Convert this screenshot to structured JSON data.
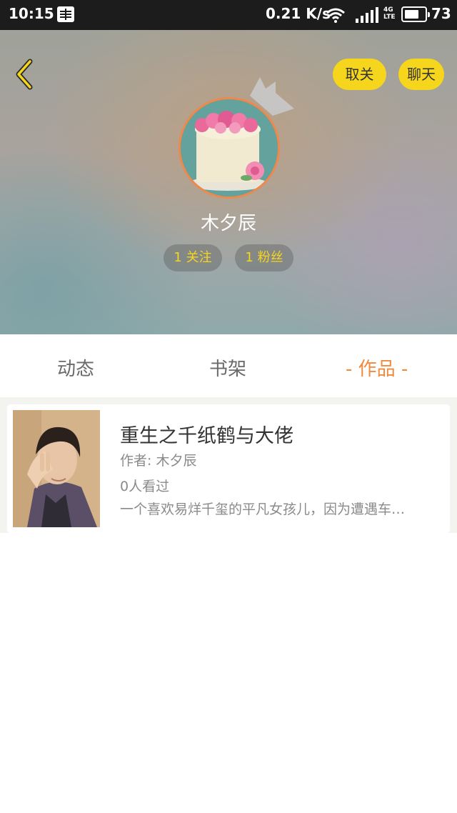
{
  "status_bar": {
    "time": "10:15",
    "speed": "0.21 K/s",
    "network_type": "4G LTE",
    "battery": "73",
    "battery_level": 0.73,
    "icons": [
      "reader-icon",
      "wifi-icon",
      "signal-icon",
      "battery-icon"
    ]
  },
  "header": {
    "back_icon": "chevron-left-icon",
    "unfollow_label": "取关",
    "chat_label": "聊天",
    "username": "木夕辰",
    "following": "1 关注",
    "fans": "1 粉丝"
  },
  "tabs": [
    {
      "label": "动态",
      "active": false
    },
    {
      "label": "书架",
      "active": false
    },
    {
      "label": "- 作品 -",
      "active": true
    }
  ],
  "works": [
    {
      "title": "重生之千纸鹤与大佬",
      "author_label": "作者: ",
      "author": "木夕辰",
      "views": "0人看过",
      "description": "一个喜欢易烊千玺的平凡女孩儿，因为遭遇车…"
    }
  ],
  "colors": {
    "accent_yellow": "#f6d61d",
    "active_tab": "#f08a3c",
    "avatar_ring": "#f0884a"
  }
}
